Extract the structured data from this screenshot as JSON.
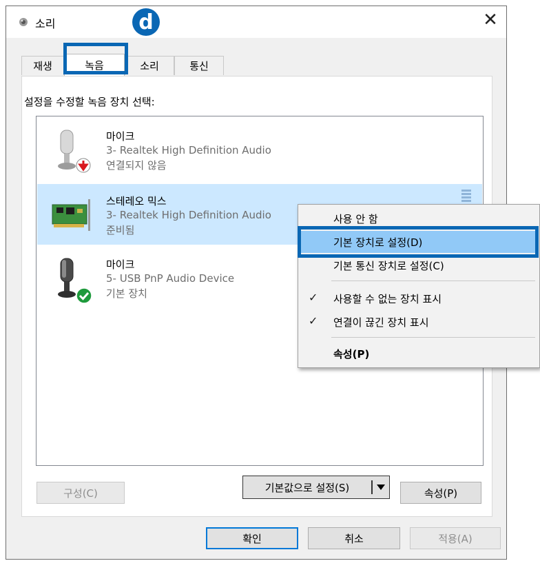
{
  "window": {
    "title": "소리",
    "close_glyph": "✕"
  },
  "step_badge": "d",
  "tabs": [
    {
      "label": "재생",
      "active": false
    },
    {
      "label": "녹음",
      "active": true
    },
    {
      "label": "소리",
      "active": false
    },
    {
      "label": "통신",
      "active": false
    }
  ],
  "instruction": "설정을 수정할 녹음 장치 선택:",
  "devices": [
    {
      "name": "마이크",
      "description": "3- Realtek High Definition Audio",
      "status": "연결되지 않음",
      "icon": "microphone-icon",
      "status_icon": "disconnected-arrow-icon",
      "selected": false
    },
    {
      "name": "스테레오 믹스",
      "description": "3- Realtek High Definition Audio",
      "status": "준비됨",
      "icon": "sound-card-icon",
      "selected": true
    },
    {
      "name": "마이크",
      "description": "5- USB PnP Audio Device",
      "status": "기본 장치",
      "icon": "microphone-icon",
      "status_icon": "default-check-icon",
      "selected": false
    }
  ],
  "buttons": {
    "configure": "구성(C)",
    "set_default": "기본값으로 설정(S)",
    "properties": "속성(P)",
    "ok": "확인",
    "cancel": "취소",
    "apply": "적용(A)"
  },
  "context_menu": [
    {
      "label": "사용 안 함",
      "checked": false
    },
    {
      "label": "기본 장치로 설정(D)",
      "checked": false,
      "highlighted": true
    },
    {
      "label": "기본 통신 장치로 설정(C)",
      "checked": false
    },
    {
      "label": "사용할 수 없는 장치 표시",
      "checked": true
    },
    {
      "label": "연결이 끊긴 장치 표시",
      "checked": true
    },
    {
      "label": "속성(P)",
      "checked": false,
      "bold": true
    }
  ],
  "colors": {
    "accent": "#0a67b4",
    "selection": "#cce8ff",
    "menu_highlight": "#91c9f7",
    "ok_green": "#1e9a3c",
    "error_red": "#d9181f"
  }
}
